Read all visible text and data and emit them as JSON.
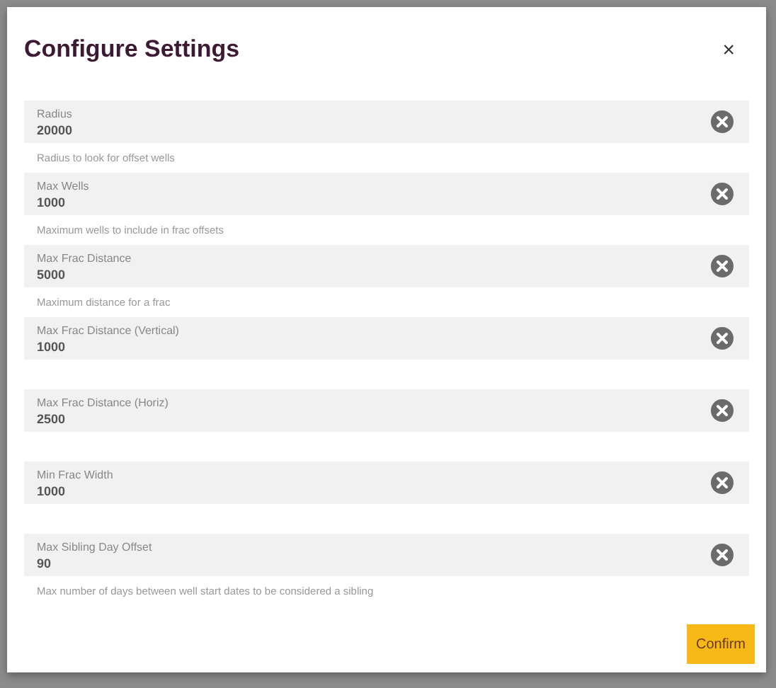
{
  "dialog": {
    "title": "Configure Settings",
    "close": "×"
  },
  "fields": [
    {
      "label": "Radius",
      "value": "20000",
      "helper": "Radius to look for offset wells"
    },
    {
      "label": "Max Wells",
      "value": "1000",
      "helper": "Maximum wells to include in frac offsets"
    },
    {
      "label": "Max Frac Distance",
      "value": "5000",
      "helper": "Maximum distance for a frac"
    },
    {
      "label": "Max Frac Distance (Vertical)",
      "value": "1000"
    },
    {
      "label": "Max Frac Distance (Horiz)",
      "value": "2500"
    },
    {
      "label": "Min Frac Width",
      "value": "1000"
    },
    {
      "label": "Max Sibling Day Offset",
      "value": "90",
      "helper": "Max number of days between well start dates to be considered a sibling"
    }
  ],
  "buttons": [
    "Confirm"
  ]
}
